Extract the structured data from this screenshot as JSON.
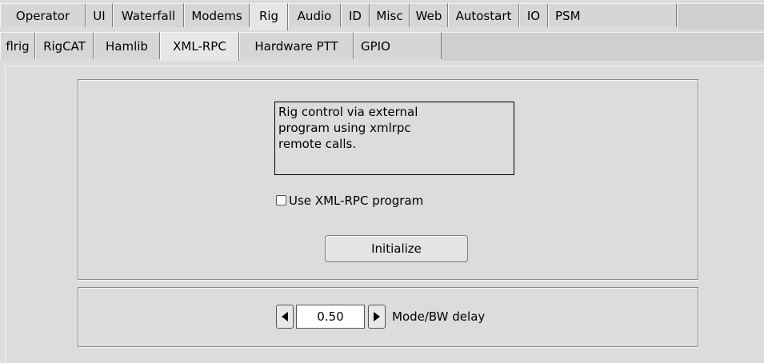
{
  "main_tabs": [
    {
      "label": "Operator"
    },
    {
      "label": "UI"
    },
    {
      "label": "Waterfall"
    },
    {
      "label": "Modems"
    },
    {
      "label": "Rig"
    },
    {
      "label": "Audio"
    },
    {
      "label": "ID"
    },
    {
      "label": "Misc"
    },
    {
      "label": "Web"
    },
    {
      "label": "Autostart"
    },
    {
      "label": "IO"
    },
    {
      "label": "PSM"
    }
  ],
  "main_tabs_active": "Rig",
  "sub_tabs": [
    {
      "label": "flrig"
    },
    {
      "label": "RigCAT"
    },
    {
      "label": "Hamlib"
    },
    {
      "label": "XML-RPC"
    },
    {
      "label": "Hardware PTT"
    },
    {
      "label": "GPIO"
    }
  ],
  "sub_tabs_active": "XML-RPC",
  "xmlrpc": {
    "description_lines": [
      "Rig control via external",
      "program using xmlrpc",
      "remote calls."
    ],
    "use_checkbox_label": "Use XML-RPC program",
    "use_checkbox_checked": false,
    "initialize_label": "Initialize",
    "delay_value": "0.50",
    "delay_label": "Mode/BW delay"
  }
}
